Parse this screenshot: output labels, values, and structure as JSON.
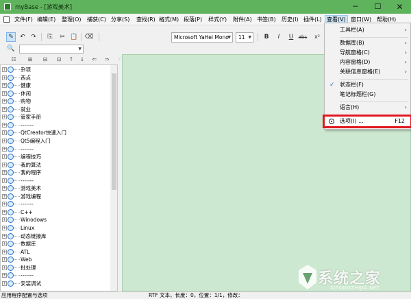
{
  "window": {
    "title": "myBase - [游戏美术]"
  },
  "controls": {
    "minimize": "─",
    "maximize": "☐",
    "close": "✕"
  },
  "menubar": {
    "items": [
      "文件(F)",
      "编辑(E)",
      "整理(O)",
      "捕获(C)",
      "分享(S)",
      "查找(R)",
      "格式(M)",
      "段落(P)",
      "样式(Y)",
      "附件(A)",
      "书签(B)",
      "历史(I)",
      "插件(L)",
      "查看(V)",
      "窗口(W)",
      "帮助(H)"
    ],
    "active_index": 13
  },
  "toolbar": {
    "font_name": "Microsoft YaHei Mono",
    "font_size": "11",
    "bold": "B",
    "italic": "I",
    "underline": "U",
    "strike": "abc",
    "superscript": "x²"
  },
  "tree": {
    "items": [
      {
        "label": "杂项",
        "expanded": false
      },
      {
        "label": "西点",
        "expanded": false
      },
      {
        "label": "健康",
        "expanded": false
      },
      {
        "label": "休闲",
        "expanded": false
      },
      {
        "label": "购物",
        "expanded": false
      },
      {
        "label": "就业",
        "expanded": false
      },
      {
        "label": "管家手册",
        "expanded": false
      },
      {
        "label": "-------",
        "expanded": false
      },
      {
        "label": "QtCreator快速入门",
        "expanded": false
      },
      {
        "label": "Qt5编程入门",
        "expanded": false
      },
      {
        "label": "-------",
        "expanded": false
      },
      {
        "label": "编程技巧",
        "expanded": false
      },
      {
        "label": "我的算法",
        "expanded": false
      },
      {
        "label": "我的程序",
        "expanded": false
      },
      {
        "label": "-------",
        "expanded": false
      },
      {
        "label": "游戏美术",
        "expanded": false
      },
      {
        "label": "游戏编程",
        "expanded": false
      },
      {
        "label": "-------",
        "expanded": false
      },
      {
        "label": "C++",
        "expanded": false
      },
      {
        "label": "Winodows",
        "expanded": false
      },
      {
        "label": "Linux",
        "expanded": false
      },
      {
        "label": "动态链接库",
        "expanded": false
      },
      {
        "label": "数据库",
        "expanded": false
      },
      {
        "label": "ATL",
        "expanded": false
      },
      {
        "label": "Web",
        "expanded": false
      },
      {
        "label": "批处理",
        "expanded": false
      },
      {
        "label": "-------",
        "expanded": false
      },
      {
        "label": "安装调试",
        "expanded": false
      }
    ]
  },
  "view_menu": {
    "items": [
      {
        "label": "工具栏(A)",
        "submenu": true
      },
      {
        "label": "数据库(B)",
        "submenu": true
      },
      {
        "label": "导航窗格(C)",
        "submenu": true
      },
      {
        "label": "内容窗格(D)",
        "submenu": true
      },
      {
        "label": "关联信息窗格(E)",
        "submenu": true
      },
      {
        "label": "状态栏(F)",
        "checked": true
      },
      {
        "label": "笔记标题栏(G)"
      },
      {
        "label": "语言(H)",
        "submenu": true
      },
      {
        "label": "选项(I) ...",
        "shortcut": "F12",
        "highlighted": true
      }
    ]
  },
  "status": {
    "left": "应用程序配置与选项",
    "middle": "RTF 文本，长度：0，位置：1/1，修改："
  },
  "watermark": {
    "text": "系统之家",
    "sub": "XITONGZHIJIA.NET"
  },
  "colors": {
    "title_bar": "#5fb35d",
    "editor_bg": "#cde8d0",
    "highlight_border": "#e0191f"
  }
}
